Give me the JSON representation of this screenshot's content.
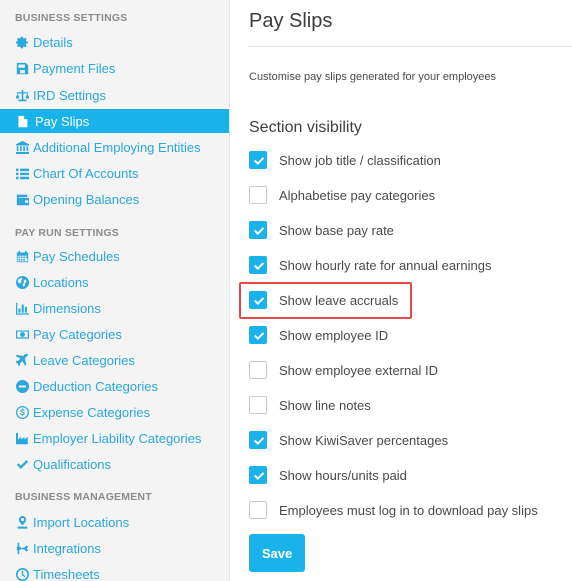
{
  "sidebar": {
    "sections": [
      {
        "title": "BUSINESS SETTINGS",
        "items": [
          {
            "label": "Details",
            "icon": "gear-icon",
            "active": false
          },
          {
            "label": "Payment Files",
            "icon": "floppy-icon",
            "active": false
          },
          {
            "label": "IRD Settings",
            "icon": "scale-icon",
            "active": false
          },
          {
            "label": "Pay Slips",
            "icon": "document-icon",
            "active": true
          },
          {
            "label": "Additional Employing Entities",
            "icon": "bank-icon",
            "active": false
          },
          {
            "label": "Chart Of Accounts",
            "icon": "list-icon",
            "active": false
          },
          {
            "label": "Opening Balances",
            "icon": "wallet-icon",
            "active": false
          }
        ]
      },
      {
        "title": "PAY RUN SETTINGS",
        "items": [
          {
            "label": "Pay Schedules",
            "icon": "calendar-icon",
            "active": false
          },
          {
            "label": "Locations",
            "icon": "globe-icon",
            "active": false
          },
          {
            "label": "Dimensions",
            "icon": "bar-chart-icon",
            "active": false
          },
          {
            "label": "Pay Categories",
            "icon": "money-icon",
            "active": false
          },
          {
            "label": "Leave Categories",
            "icon": "plane-icon",
            "active": false
          },
          {
            "label": "Deduction Categories",
            "icon": "minus-circle-icon",
            "active": false
          },
          {
            "label": "Expense Categories",
            "icon": "dollar-circle-icon",
            "active": false
          },
          {
            "label": "Employer Liability Categories",
            "icon": "industry-icon",
            "active": false
          },
          {
            "label": "Qualifications",
            "icon": "check-icon",
            "active": false
          }
        ]
      },
      {
        "title": "BUSINESS MANAGEMENT",
        "items": [
          {
            "label": "Import Locations",
            "icon": "map-pin-icon",
            "active": false
          },
          {
            "label": "Integrations",
            "icon": "plug-icon",
            "active": false
          },
          {
            "label": "Timesheets",
            "icon": "clock-icon",
            "active": false
          }
        ]
      }
    ]
  },
  "main": {
    "title": "Pay Slips",
    "subtitle": "Customise pay slips generated for your employees",
    "section_heading": "Section visibility",
    "options": [
      {
        "label": "Show job title / classification",
        "checked": true
      },
      {
        "label": "Alphabetise pay categories",
        "checked": false
      },
      {
        "label": "Show base pay rate",
        "checked": true
      },
      {
        "label": "Show hourly rate for annual earnings",
        "checked": true
      },
      {
        "label": "Show leave accruals",
        "checked": true
      },
      {
        "label": "Show employee ID",
        "checked": true
      },
      {
        "label": "Show employee external ID",
        "checked": false
      },
      {
        "label": "Show line notes",
        "checked": false
      },
      {
        "label": "Show KiwiSaver percentages",
        "checked": true
      },
      {
        "label": "Show hours/units paid",
        "checked": true
      },
      {
        "label": "Employees must log in to download pay slips",
        "checked": false
      }
    ],
    "save_label": "Save"
  },
  "colors": {
    "accent": "#1ab2ea",
    "link": "#2aa7dd",
    "highlight_border": "#e8484a"
  }
}
